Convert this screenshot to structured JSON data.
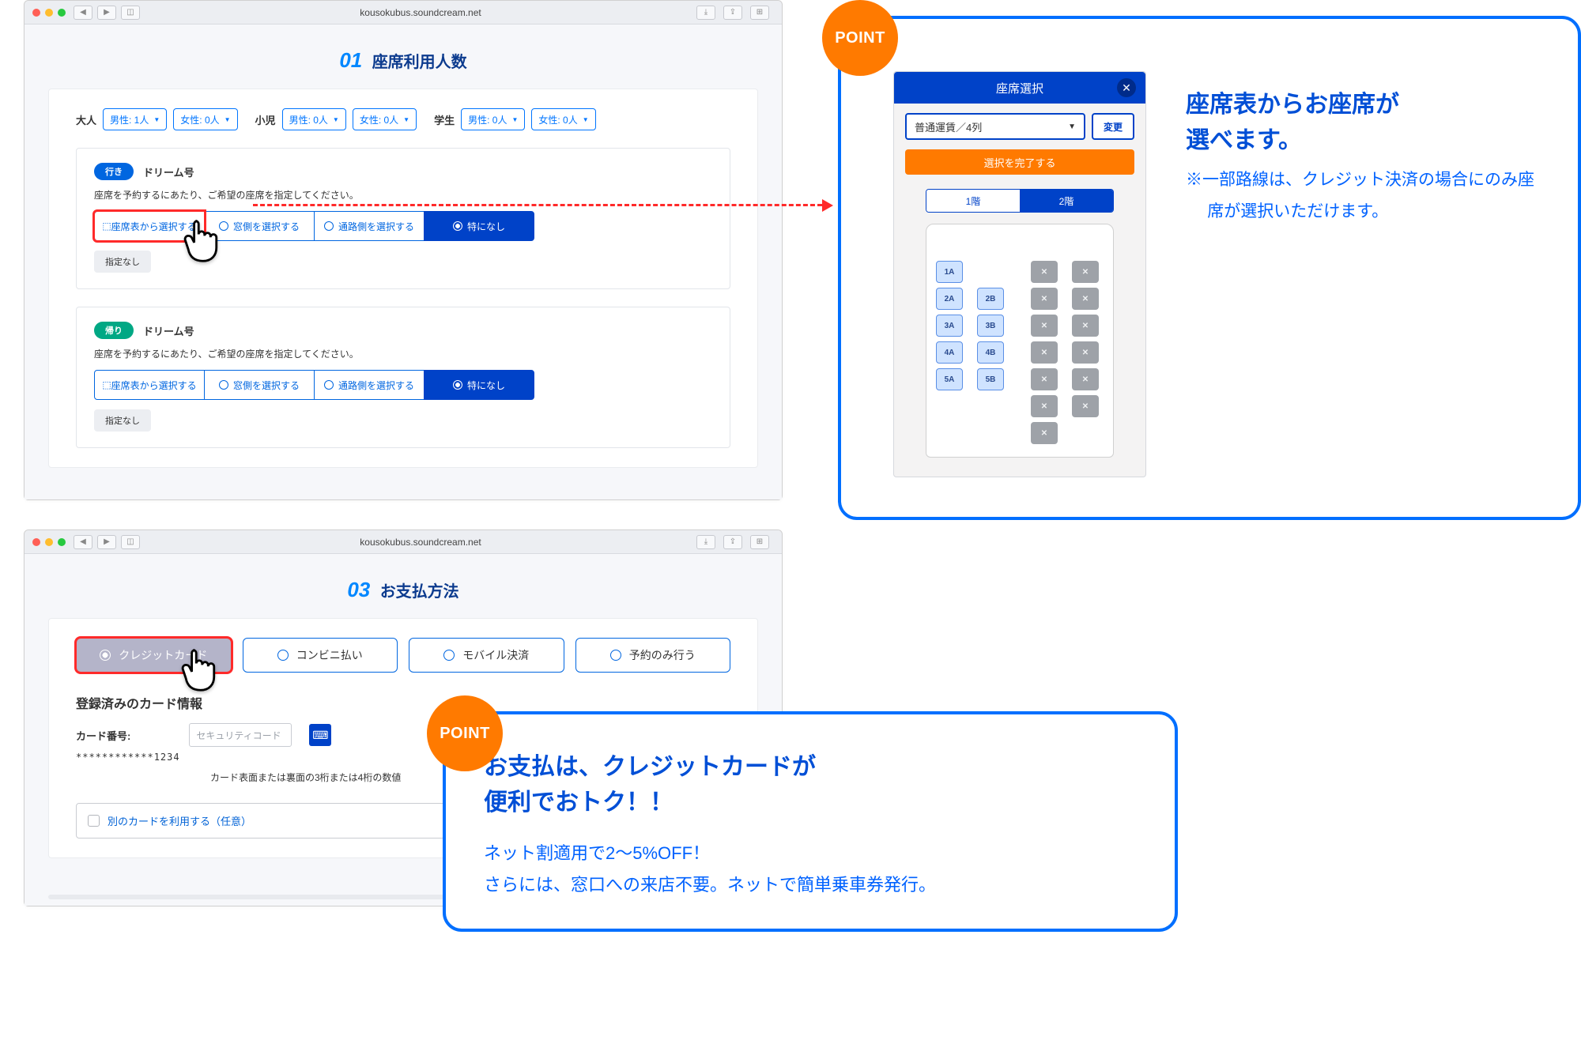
{
  "url": "kousokubus.soundcream.net",
  "section01": {
    "num": "01",
    "title": "座席利用人数",
    "pax": {
      "adult_label": "大人",
      "child_label": "小児",
      "student_label": "学生",
      "male1": "男性: 1人",
      "female0": "女性: 0人",
      "male0": "男性: 0人"
    },
    "trip_going": {
      "tag": "行き",
      "name": "ドリーム号",
      "desc": "座席を予約するにあたり、ご希望の座席を指定してください。",
      "opt1": "座席表から選択する",
      "opt2": "窓側を選択する",
      "opt3": "通路側を選択する",
      "opt4": "特になし",
      "none_btn": "指定なし"
    },
    "trip_return": {
      "tag": "帰り",
      "name": "ドリーム号",
      "desc": "座席を予約するにあたり、ご希望の座席を指定してください。",
      "opt1": "座席表から選択する",
      "opt2": "窓側を選択する",
      "opt3": "通路側を選択する",
      "opt4": "特になし",
      "none_btn": "指定なし"
    }
  },
  "section03": {
    "num": "03",
    "title": "お支払方法",
    "pay": {
      "credit": "クレジットカード",
      "conv": "コンビニ払い",
      "mobile": "モバイル決済",
      "reserve": "予約のみ行う"
    },
    "registered": {
      "title": "登録済みのカード情報",
      "label": "カード番号:",
      "masked": "************1234",
      "sec_ph": "セキュリティコード",
      "hint": "カード表面または裏面の3桁または4桁の数値"
    },
    "alt_card": "別のカードを利用する（任意）"
  },
  "pointA": {
    "badge": "POINT",
    "title_l1": "座席表からお座席が",
    "title_l2": "選べます。",
    "note": "※一部路線は、クレジット決済の場合にのみ座席が選択いただけます。",
    "seat_modal": {
      "header": "座席選択",
      "select_value": "普通運賃／4列",
      "change": "変更",
      "finish": "選択を完了する",
      "floor1": "1階",
      "floor2": "2階",
      "rows": [
        {
          "a": "1A",
          "b": "",
          "c": "x",
          "d": "x"
        },
        {
          "a": "2A",
          "b": "2B",
          "c": "x",
          "d": "x"
        },
        {
          "a": "3A",
          "b": "3B",
          "c": "x",
          "d": "x"
        },
        {
          "a": "4A",
          "b": "4B",
          "c": "x",
          "d": "x"
        },
        {
          "a": "5A",
          "b": "5B",
          "c": "x",
          "d": "x"
        },
        {
          "a": "",
          "b": "",
          "c": "x",
          "d": "x"
        },
        {
          "a": "",
          "b": "",
          "c": "x",
          "d": ""
        }
      ]
    }
  },
  "pointB": {
    "badge": "POINT",
    "title_l1": "お支払は、クレジットカードが",
    "title_l2": "便利でおトク！！",
    "sub_l1": "ネット割適用で2〜5%OFF！",
    "sub_l2": "さらには、窓口への来店不要。ネットで簡単乗車券発行。"
  }
}
